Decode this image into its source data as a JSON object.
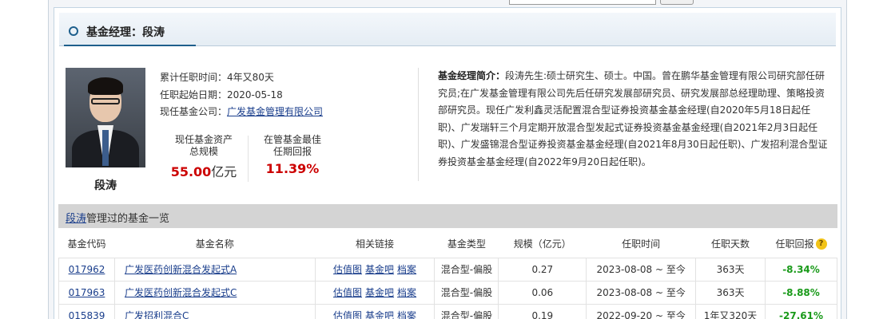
{
  "section_title": "基金经理：段涛",
  "manager": {
    "name": "段涛",
    "tenure_label": "累计任职时间：",
    "tenure": "4年又80天",
    "start_label": "任职起始日期：",
    "start_date": "2020-05-18",
    "company_label": "现任基金公司：",
    "company": "广发基金管理有限公司"
  },
  "stats": {
    "assets_label_1": "现任基金资产",
    "assets_label_2": "总规模",
    "assets_value": "55.00",
    "assets_unit": "亿元",
    "best_label_1": "在管基金最佳",
    "best_label_2": "任期回报",
    "best_value": "11.39%"
  },
  "bio": {
    "label": "基金经理简介：",
    "text": "段涛先生:硕士研究生、硕士。中国。曾在鹏华基金管理有限公司研究部任研究员;在广发基金管理有限公司先后任研究发展部研究员、研究发展部总经理助理、策略投资部研究员。现任广发利鑫灵活配置混合型证券投资基金基金经理(自2020年5月18日起任职)、广发瑞轩三个月定期开放混合型发起式证券投资基金基金经理(自2021年2月3日起任职)、广发盛锦混合型证券投资基金基金经理(自2021年8月30日起任职)、广发招利混合型证券投资基金基金经理(自2022年9月20日起任职)。"
  },
  "fund_list": {
    "name_link": "段涛",
    "title_rest": "管理过的基金一览",
    "columns": [
      "基金代码",
      "基金名称",
      "相关链接",
      "基金类型",
      "规模（亿元）",
      "任职时间",
      "任职天数",
      "任职回报"
    ],
    "link_labels": [
      "估值图",
      "基金吧",
      "档案"
    ],
    "rows": [
      {
        "code": "017962",
        "name": "广发医药创新混合发起式A",
        "type": "混合型-偏股",
        "size": "0.27",
        "period": "2023-08-08 ~ 至今",
        "days": "363天",
        "return": "-8.34%"
      },
      {
        "code": "017963",
        "name": "广发医药创新混合发起式C",
        "type": "混合型-偏股",
        "size": "0.06",
        "period": "2023-08-08 ~ 至今",
        "days": "363天",
        "return": "-8.88%"
      },
      {
        "code": "015839",
        "name": "广发招利混合C",
        "type": "混合型-偏股",
        "size": "0.19",
        "period": "2022-09-20 ~ 至今",
        "days": "1年又320天",
        "return": "-27.61%"
      }
    ]
  },
  "colors": {
    "accent": "#1e5f8c",
    "value_red": "#cc0000",
    "return_green": "#1a9a1a",
    "list_header_bg": "#d4d4d4"
  },
  "icons": {
    "help": "question-icon",
    "title": "circle-icon"
  }
}
